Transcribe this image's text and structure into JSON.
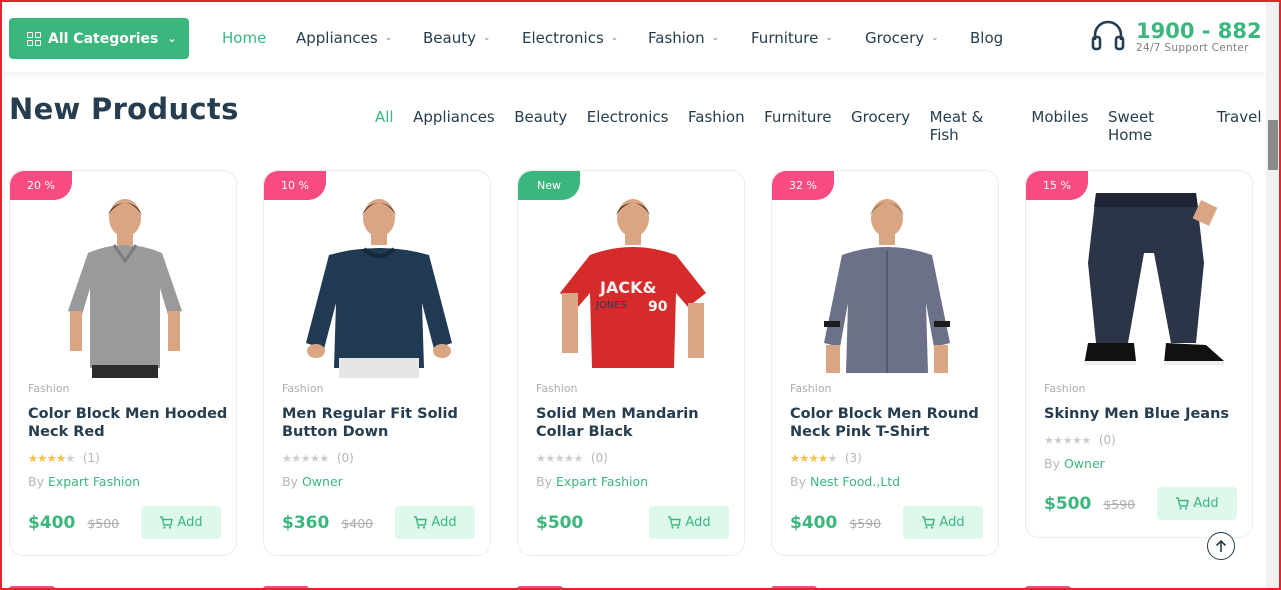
{
  "header": {
    "all_categories": "All Categories",
    "nav": [
      {
        "label": "Home",
        "active": true,
        "dropdown": false
      },
      {
        "label": "Appliances",
        "dropdown": true
      },
      {
        "label": "Beauty",
        "dropdown": true
      },
      {
        "label": "Electronics",
        "dropdown": true
      },
      {
        "label": "Fashion",
        "dropdown": true
      },
      {
        "label": "Furniture",
        "dropdown": true
      },
      {
        "label": "Grocery",
        "dropdown": true
      },
      {
        "label": "Blog",
        "dropdown": false
      }
    ],
    "support_phone": "1900 - 882",
    "support_label": "24/7 Support Center"
  },
  "section": {
    "title": "New Products",
    "filters": [
      "All",
      "Appliances",
      "Beauty",
      "Electronics",
      "Fashion",
      "Furniture",
      "Grocery",
      "Meat & Fish",
      "Mobiles",
      "Sweet Home",
      "Travel"
    ],
    "active_filter": "All"
  },
  "products": [
    {
      "badge": "20 %",
      "badge_type": "sale",
      "category": "Fashion",
      "name": "Color Block Men Hooded Neck Red",
      "rating": 4,
      "reviews": "(1)",
      "by_label": "By",
      "vendor": "Expart Fashion",
      "price": "$400",
      "old_price": "$500",
      "add_label": "Add",
      "image": "grey-polo-tshirt"
    },
    {
      "badge": "10 %",
      "badge_type": "sale",
      "category": "Fashion",
      "name": "Men Regular Fit Solid Button Down",
      "rating": 0,
      "reviews": "(0)",
      "by_label": "By",
      "vendor": "Owner",
      "price": "$360",
      "old_price": "$400",
      "add_label": "Add",
      "image": "navy-sweater"
    },
    {
      "badge": "New",
      "badge_type": "new",
      "category": "Fashion",
      "name": "Solid Men Mandarin Collar Black",
      "rating": 0,
      "reviews": "(0)",
      "by_label": "By",
      "vendor": "Expart Fashion",
      "price": "$500",
      "old_price": "",
      "add_label": "Add",
      "image": "red-graphic-tshirt"
    },
    {
      "badge": "32 %",
      "badge_type": "sale",
      "category": "Fashion",
      "name": "Color Block Men Round Neck Pink T-Shirt",
      "rating": 4,
      "reviews": "(3)",
      "by_label": "By",
      "vendor": "Nest Food.,Ltd",
      "price": "$400",
      "old_price": "$590",
      "add_label": "Add",
      "image": "grey-button-shirt"
    },
    {
      "badge": "15 %",
      "badge_type": "sale",
      "category": "Fashion",
      "name": "Skinny Men Blue Jeans",
      "rating": 0,
      "reviews": "(0)",
      "by_label": "By",
      "vendor": "Owner",
      "price": "$500",
      "old_price": "$590",
      "add_label": "Add",
      "image": "navy-jogger-pants"
    }
  ],
  "icons": {
    "all_categories": "grid-icon",
    "support": "headset-icon",
    "cart": "cart-icon",
    "back_to_top": "arrow-up-icon"
  },
  "colors": {
    "brand": "#3bb77e",
    "sale_badge": "#f74b81",
    "text": "#253d4e",
    "star": "#fdc040"
  }
}
